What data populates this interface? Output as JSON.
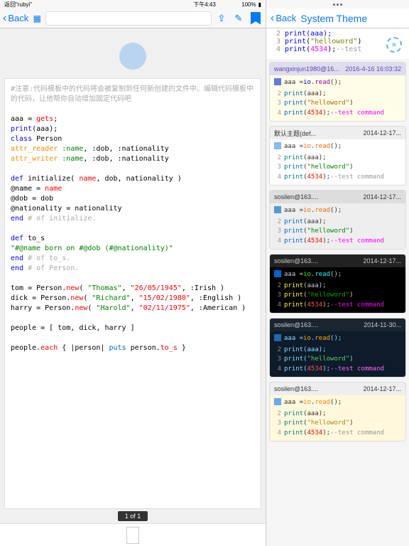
{
  "status": {
    "back_app": "返回\"rubyi\"",
    "time": "下午4:43",
    "battery": "100%"
  },
  "toolbar": {
    "back": "Back"
  },
  "doc": {
    "comment": "#注意:代码模板中的代码将会被复制到任何新创建的文件中。编辑代码模板中的代码，让他帮你自动增加固定代码吧",
    "l1a": "aaa = ",
    "l1b": "gets",
    "l1c": ";",
    "l2a": "print",
    "l2b": "(aaa);",
    "l3a": "class",
    "l3b": " Person",
    "l4a": "  ",
    "l4b": "attr_reader",
    "l4c": " :name",
    "l4d": ", :dob, :nationality",
    "l5a": "  ",
    "l5b": "attr_writer",
    "l5c": " :name",
    "l5d": ", :dob, :nationality",
    "l6a": "  ",
    "l6b": "def",
    "l6c": " initialize( ",
    "l6d": "name",
    "l6e": ", dob, nationality )",
    "l7": "    @name = ",
    "l7b": "name",
    "l8": "    @dob = dob",
    "l9": "    @nationality = nationality",
    "l10a": "  ",
    "l10b": "end",
    "l10c": " # of initialize.",
    "l11a": "  ",
    "l11b": "def",
    "l11c": " to_s",
    "l12": "    \"#@name born on #@dob (#@nationality)\"",
    "l13a": "  ",
    "l13b": "end",
    "l13c": " # of to_s.",
    "l14a": "end",
    "l14b": " # of Person.",
    "p1a": "tom  = Person.",
    "p1b": "new",
    "p1c": "( ",
    "p1d": "\"Thomas\"",
    "p1e": ", ",
    "p1f": "\"26/05/1945\"",
    "p1g": ", :Irish )",
    "p2a": "dick  = Person.",
    "p2b": "new",
    "p2c": "( ",
    "p2d": "\"Richard\"",
    "p2e": ", ",
    "p2f": "\"15/02/1980\"",
    "p2g": ", :English )",
    "p3a": "harry = Person.",
    "p3b": "new",
    "p3c": "( ",
    "p3d": "\"Harold\"",
    "p3e": ", ",
    "p3f": "\"02/11/1975\"",
    "p3g": ", :American )",
    "pe": "people = [ tom, dick, harry ]",
    "ea": "people.",
    "eb": "each",
    "ec": " { |person| ",
    "ed": "puts",
    "ee": " person.",
    "ef": "to_s",
    "eg": " }"
  },
  "page_indicator": "1 of 1",
  "right": {
    "back": "Back",
    "title": "System Theme",
    "preview": {
      "l2n": "2",
      "l2": "print(aaa);",
      "l3n": "3",
      "l3a": "print",
      "l3b": "(",
      "l3c": "\"helloword\"",
      "l3d": ")",
      "l4n": "4",
      "l4a": "print",
      "l4b": "(",
      "l4c": "4534",
      "l4d": ");",
      "l4e": "--test"
    },
    "cards": [
      {
        "user": "wangxinjun1980@16...",
        "date": "2016-4-16 16:03:32"
      },
      {
        "user": "默认主题(def...",
        "date": "2014-12-17..."
      },
      {
        "user": "sosilen@163....",
        "date": "2014-12-17..."
      },
      {
        "user": "sosilen@163....",
        "date": "2014-12-17..."
      },
      {
        "user": "sosilen@163....",
        "date": "2014-11-30..."
      },
      {
        "user": "sosilen@163....",
        "date": "2014-12-17..."
      }
    ],
    "code": {
      "l1a": "aaa = ",
      "l1b": "io",
      "l1c": ".",
      "l1d": "read",
      "l1e": "();",
      "l2a": "print",
      "l2b": "(aaa);",
      "l3a": "print",
      "l3b": "(",
      "l3c": "\"helloword\"",
      "l3d": ")",
      "l4a": "print",
      "l4b": "(",
      "l4c": "4534",
      "l4d": ");",
      "l4e": "--test command"
    }
  }
}
